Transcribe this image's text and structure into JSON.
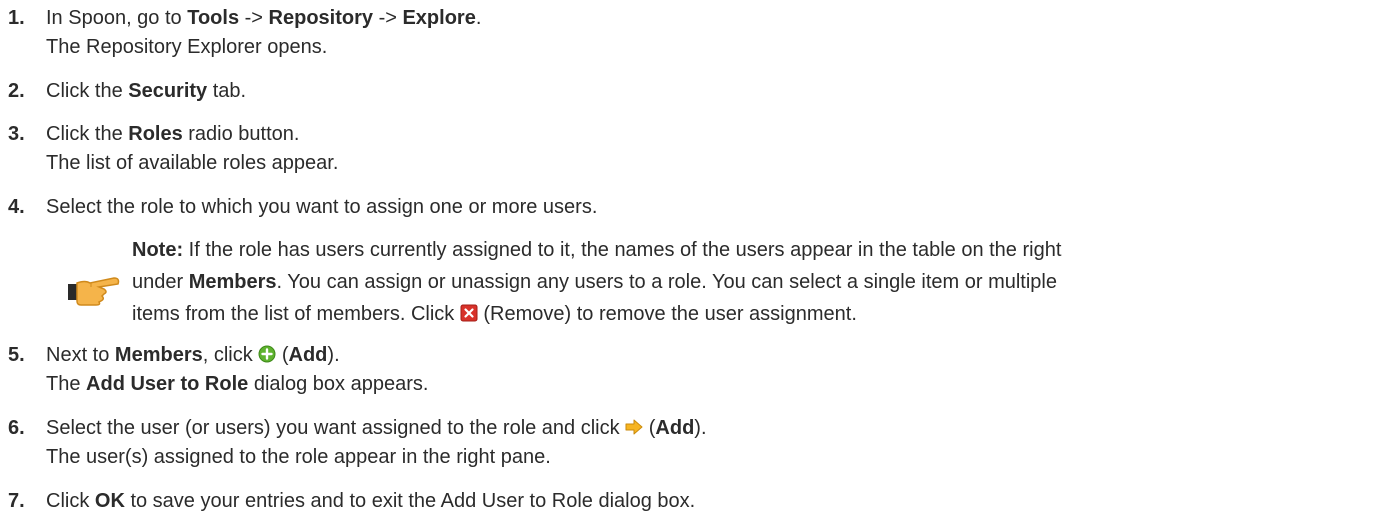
{
  "steps": [
    {
      "number": "1.",
      "line1": {
        "pre": "In Spoon, go to ",
        "b1": "Tools",
        "mid1": " -> ",
        "b2": "Repository",
        "mid2": " -> ",
        "b3": "Explore",
        "post": "."
      },
      "line2": "The Repository Explorer opens."
    },
    {
      "number": "2.",
      "line1": {
        "pre": "Click the ",
        "b1": "Security",
        "post": " tab."
      }
    },
    {
      "number": "3.",
      "line1": {
        "pre": "Click the ",
        "b1": "Roles",
        "post": " radio button."
      },
      "line2": "The list of available roles appear."
    },
    {
      "number": "4.",
      "line1": {
        "pre": "Select the role to which you want to assign one or more users."
      }
    },
    {
      "number": "5.",
      "line1": {
        "pre": "Next to ",
        "b1": "Members",
        "mid1": ", click ",
        "mid2": " (",
        "b2": "Add",
        "post": ")."
      },
      "line2": {
        "pre": "The ",
        "b1": "Add User to Role",
        "post": " dialog box appears."
      }
    },
    {
      "number": "6.",
      "line1": {
        "pre": "Select the user (or users) you want assigned to the role and click ",
        "mid1": " (",
        "b1": "Add",
        "post": ")."
      },
      "line2": "The user(s) assigned to the role appear in the right pane."
    },
    {
      "number": "7.",
      "line1": {
        "pre": "Click ",
        "b1": "OK",
        "post": " to save your entries and to exit the Add User to Role dialog box."
      }
    }
  ],
  "note": {
    "label": "Note:",
    "line1": " If the role has users currently assigned to it, the names of the users appear in the table on the right",
    "line2": {
      "pre": "under ",
      "b1": "Members",
      "post": ". You can assign or unassign any users to a role. You can select a single item or multiple"
    },
    "line3": {
      "pre": "items from the list of members. Click ",
      "post": " (Remove) to remove the user assignment."
    }
  },
  "icons": {
    "note": "pointing-hand-icon",
    "remove": "remove-icon",
    "add": "add-icon",
    "add_arrow": "arrow-right-icon"
  },
  "colors": {
    "text": "#2b2b2b",
    "remove_icon": "#d8322a",
    "add_icon": "#5fb32f",
    "arrow_icon": "#f6b421"
  }
}
